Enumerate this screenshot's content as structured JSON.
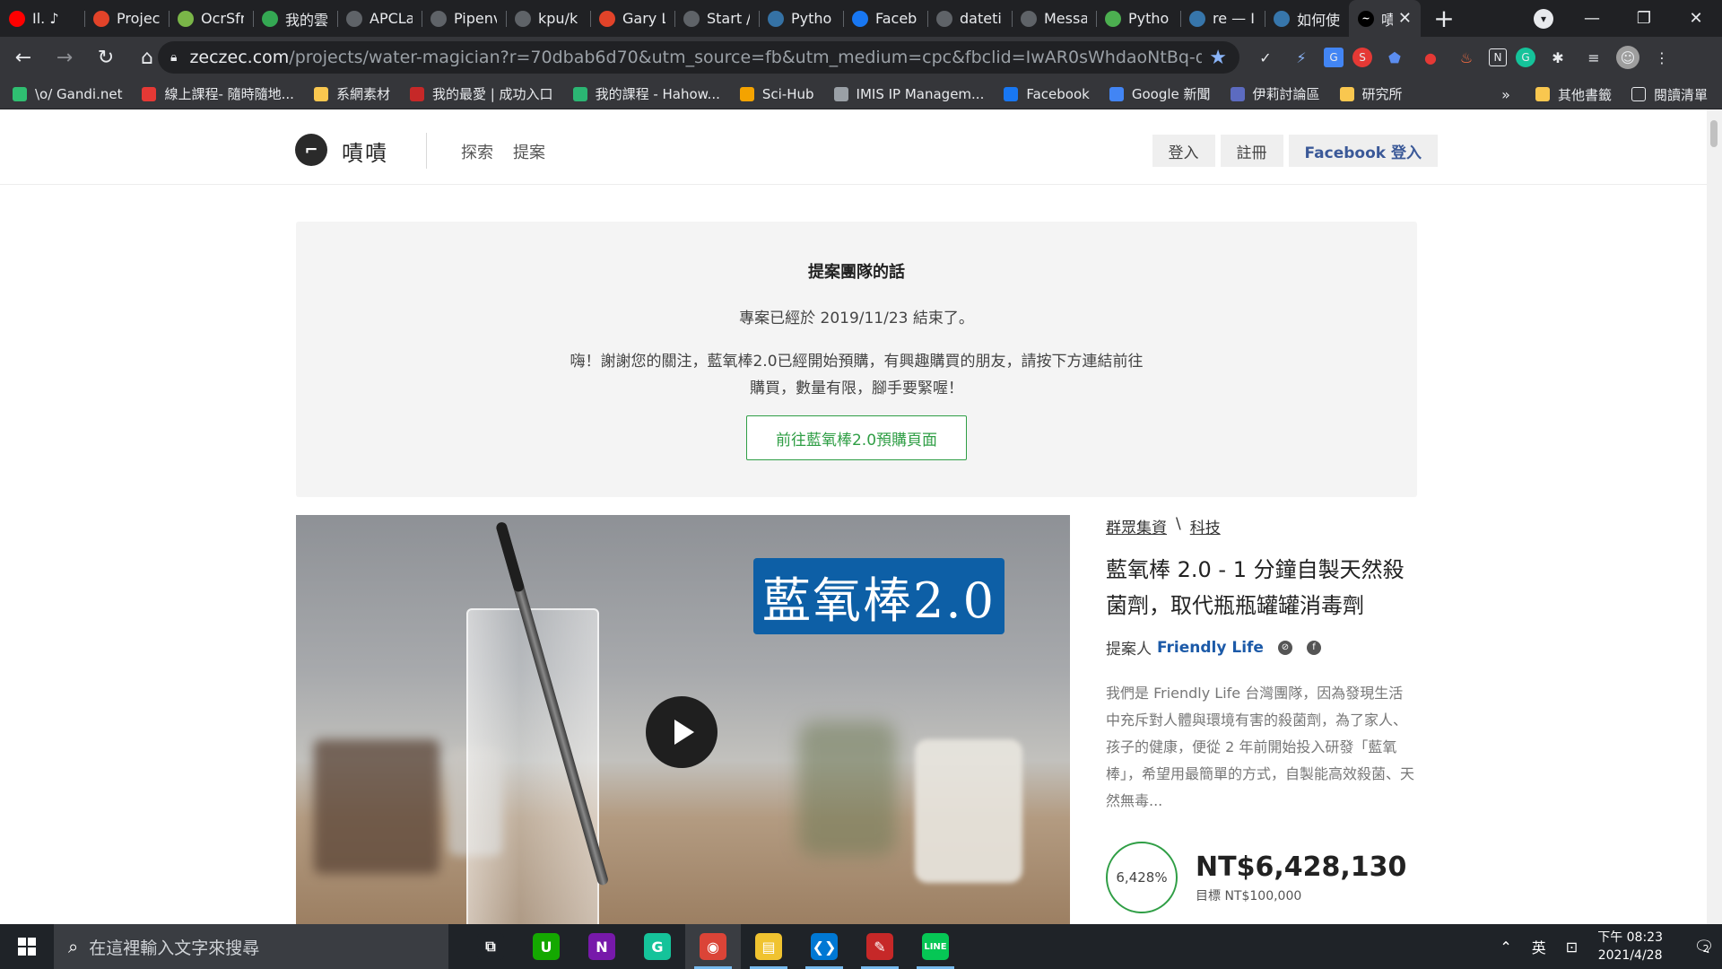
{
  "browser": {
    "tabs": [
      {
        "title": "Il. ♪",
        "icon": "youtube-icon",
        "color": "#ff0000"
      },
      {
        "title": "Projec",
        "icon": "gitlab-icon",
        "color": "#e24329"
      },
      {
        "title": "OcrSfr",
        "icon": "ocr-icon",
        "color": "#7ab648"
      },
      {
        "title": "我的雲",
        "icon": "google-drive-icon",
        "color": "#34a853"
      },
      {
        "title": "APCLa",
        "icon": "github-icon",
        "color": "#ffffff"
      },
      {
        "title": "Pipenv",
        "icon": "medium-icon",
        "color": "#ffffff"
      },
      {
        "title": "kpu/k",
        "icon": "github-icon",
        "color": "#ffffff"
      },
      {
        "title": "Gary L",
        "icon": "gitlab-icon",
        "color": "#e24329"
      },
      {
        "title": "Start /",
        "icon": "start-icon",
        "color": "#ffffff"
      },
      {
        "title": "Pytho",
        "icon": "python-doc-icon",
        "color": "#3572a5"
      },
      {
        "title": "Faceb",
        "icon": "facebook-icon",
        "color": "#1877f2"
      },
      {
        "title": "dateti",
        "icon": "google-icon",
        "color": "#ffffff"
      },
      {
        "title": "Messa",
        "icon": "google-icon",
        "color": "#ffffff"
      },
      {
        "title": "Pytho",
        "icon": "python-icon",
        "color": "#4caf50"
      },
      {
        "title": "re — I",
        "icon": "python-icon",
        "color": "#3776ab"
      },
      {
        "title": "如何使",
        "icon": "python-icon",
        "color": "#3776ab"
      }
    ],
    "active_tab": {
      "title": "嘖",
      "icon": "zeczec-icon"
    },
    "url_host": "zeczec.com",
    "url_rest": "/projects/water-magician?r=70dbab6d70&utm_source=fb&utm_medium=cpc&fbclid=IwAR0sWhdaoNtBq-dxOfLKWwzS...",
    "bookmarks": [
      {
        "label": "\\o/ Gandi.net",
        "icon": "gandi-icon",
        "color": "#2fbf71"
      },
      {
        "label": "線上課程- 隨時隨地...",
        "icon": "course-icon",
        "color": "#e53935"
      },
      {
        "label": "系網素材",
        "icon": "folder-icon",
        "color": "#f9c74f"
      },
      {
        "label": "我的最愛 | 成功入口",
        "icon": "favorite-icon",
        "color": "#c62828"
      },
      {
        "label": "我的課程 - Hahow...",
        "icon": "hahow-icon",
        "color": "#2bb673"
      },
      {
        "label": "Sci-Hub",
        "icon": "scihub-icon",
        "color": "#f4a300"
      },
      {
        "label": "IMIS IP Managem...",
        "icon": "globe-icon",
        "color": "#9aa0a6"
      },
      {
        "label": "Facebook",
        "icon": "facebook-icon",
        "color": "#1877f2"
      },
      {
        "label": "Google 新聞",
        "icon": "google-news-icon",
        "color": "#4285f4"
      },
      {
        "label": "伊莉討論區",
        "icon": "forum-icon",
        "color": "#5c6bc0"
      },
      {
        "label": "研究所",
        "icon": "folder-icon",
        "color": "#f9c74f"
      }
    ],
    "bookmarks_more": "»",
    "other_bookmarks": "其他書籤",
    "reading_list": "閱讀清單"
  },
  "site": {
    "brand": "嘖嘖",
    "nav": [
      "探索",
      "提案"
    ],
    "login": "登入",
    "register": "註冊",
    "fb_login": "Facebook 登入"
  },
  "notice": {
    "title": "提案團隊的話",
    "date_line": "專案已經於 2019/11/23 結束了。",
    "message": "嗨！謝謝您的關注，藍氧棒2.0已經開始預購，有興趣購買的朋友，請按下方連結前往購買，數量有限，腳手要緊喔！",
    "button": "前往藍氧棒2.0預購頁面"
  },
  "video": {
    "sign_text": "藍氧棒2.0"
  },
  "project": {
    "crumb_1": "群眾集資",
    "crumb_sep": "\\",
    "crumb_2": "科技",
    "title": "藍氧棒 2.0 - 1 分鐘自製天然殺菌劑，取代瓶瓶罐罐消毒劑",
    "proposer_label": "提案人",
    "proposer_name": "Friendly Life",
    "description": "我們是 Friendly Life 台灣團隊，因為發現生活中充斥對人體與環境有害的殺菌劑，為了家人、孩子的健康，便從 2 年前開始投入研發「藍氧棒」，希望用最簡單的方式，自製能高效殺菌、天然無毒...",
    "percent": "6,428%",
    "amount": "NT$6,428,130",
    "goal": "目標 NT$100,000"
  },
  "taskbar": {
    "search_placeholder": "在這裡輸入文字來搜尋",
    "apps": [
      {
        "name": "task-view",
        "glyph": "⧉",
        "color": "#1f2328"
      },
      {
        "name": "upwork",
        "glyph": "U",
        "color": "#14a800"
      },
      {
        "name": "onenote",
        "glyph": "N",
        "color": "#7719aa"
      },
      {
        "name": "grammarly",
        "glyph": "G",
        "color": "#15c39a"
      },
      {
        "name": "chrome",
        "glyph": "◉",
        "color": "#db4437"
      },
      {
        "name": "file-explorer",
        "glyph": "▤",
        "color": "#f0c330"
      },
      {
        "name": "vscode",
        "glyph": "❮❯",
        "color": "#0078d4"
      },
      {
        "name": "draw",
        "glyph": "✎",
        "color": "#c62828"
      },
      {
        "name": "line",
        "glyph": "LINE",
        "color": "#06c755"
      }
    ],
    "ime": "英",
    "time": "下午 08:23",
    "date": "2021/4/28",
    "notifications": "2"
  }
}
